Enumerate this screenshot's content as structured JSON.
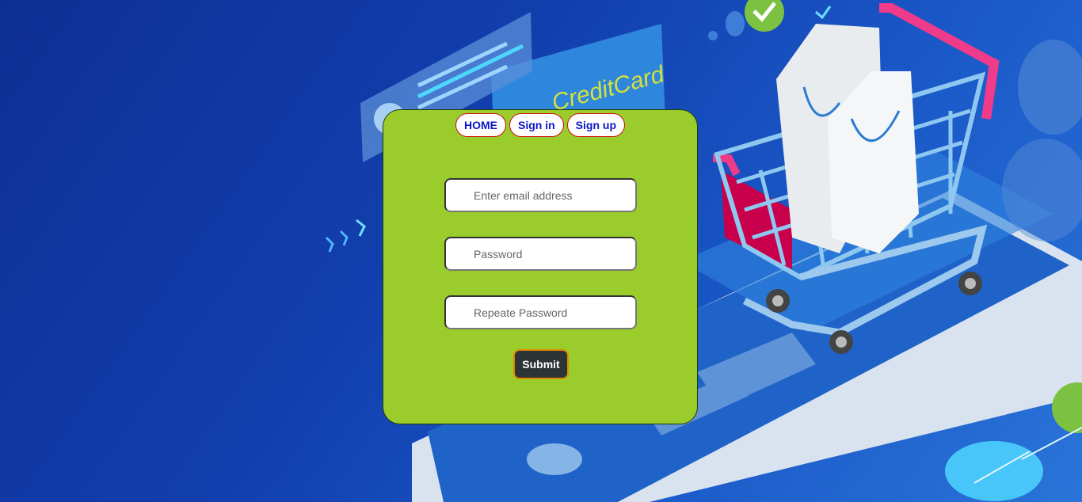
{
  "nav": {
    "home_label": "HOME",
    "signin_label": "Sign in",
    "signup_label": "Sign up"
  },
  "form": {
    "email_placeholder": "Enter email address",
    "password_placeholder": "Password",
    "repeat_password_placeholder": "Repeate Password",
    "submit_label": "Submit"
  },
  "background": {
    "card_text": "CreditCard"
  },
  "colors": {
    "card_bg": "#9acd2b",
    "nav_text": "#0a14c8",
    "nav_border": "#d01010",
    "submit_bg": "#2d3436",
    "submit_border": "#e08a00"
  }
}
